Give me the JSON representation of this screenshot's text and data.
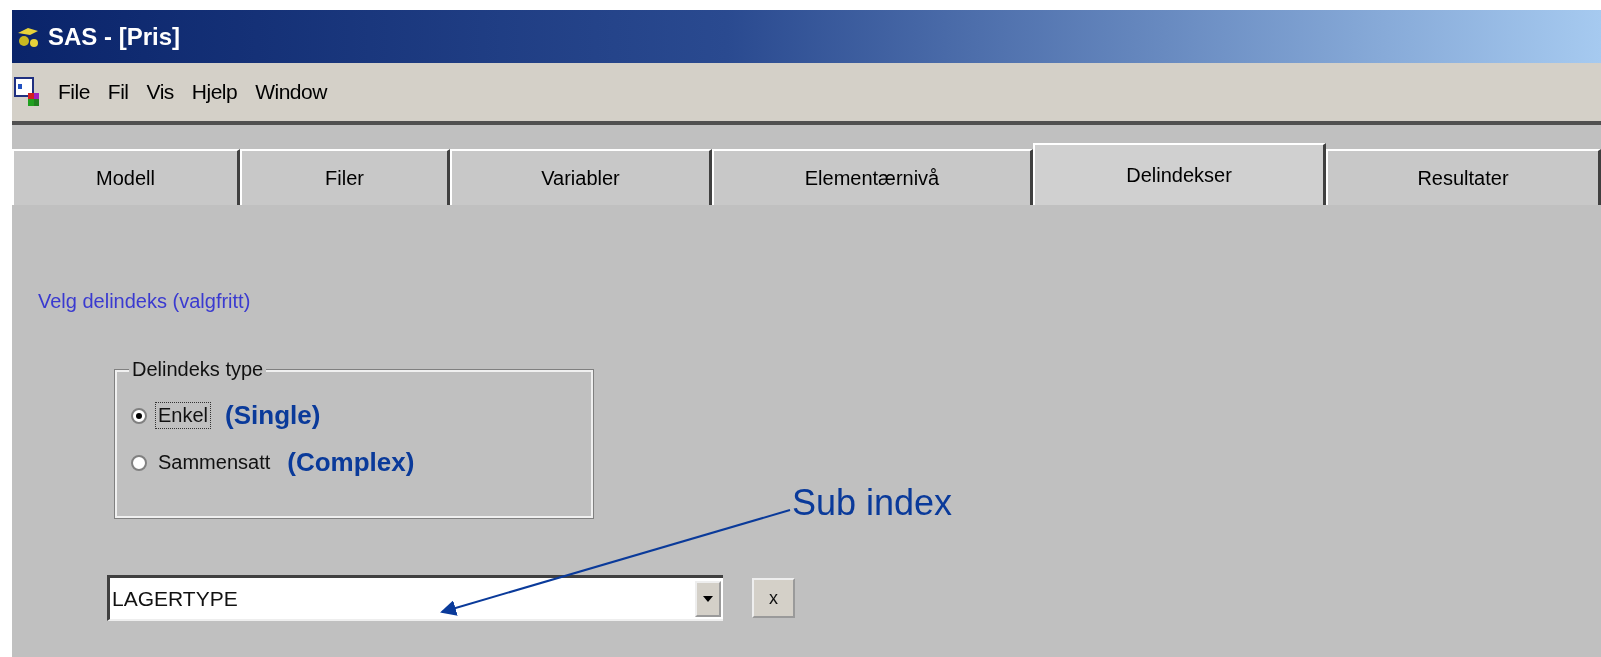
{
  "window": {
    "title": "SAS - [Pris]"
  },
  "menu": [
    "File",
    "Fil",
    "Vis",
    "Hjelp",
    "Window"
  ],
  "tabs": [
    {
      "label": "Modell",
      "selected": false
    },
    {
      "label": "Filer",
      "selected": false
    },
    {
      "label": "Variabler",
      "selected": false
    },
    {
      "label": "Elementærnivå",
      "selected": false
    },
    {
      "label": "Delindekser",
      "selected": true
    },
    {
      "label": "Resultater",
      "selected": false
    }
  ],
  "section_label": "Velg delindeks (valgfritt)",
  "group": {
    "title": "Delindeks type",
    "options": [
      {
        "label": "Enkel",
        "annotation": "(Single)",
        "selected": true,
        "focused": true
      },
      {
        "label": "Sammensatt",
        "annotation": "(Complex)",
        "selected": false,
        "focused": false
      }
    ]
  },
  "subindex": {
    "value": "LAGERTYPE",
    "clear_button": "x"
  },
  "callout": {
    "label": "Sub index"
  }
}
